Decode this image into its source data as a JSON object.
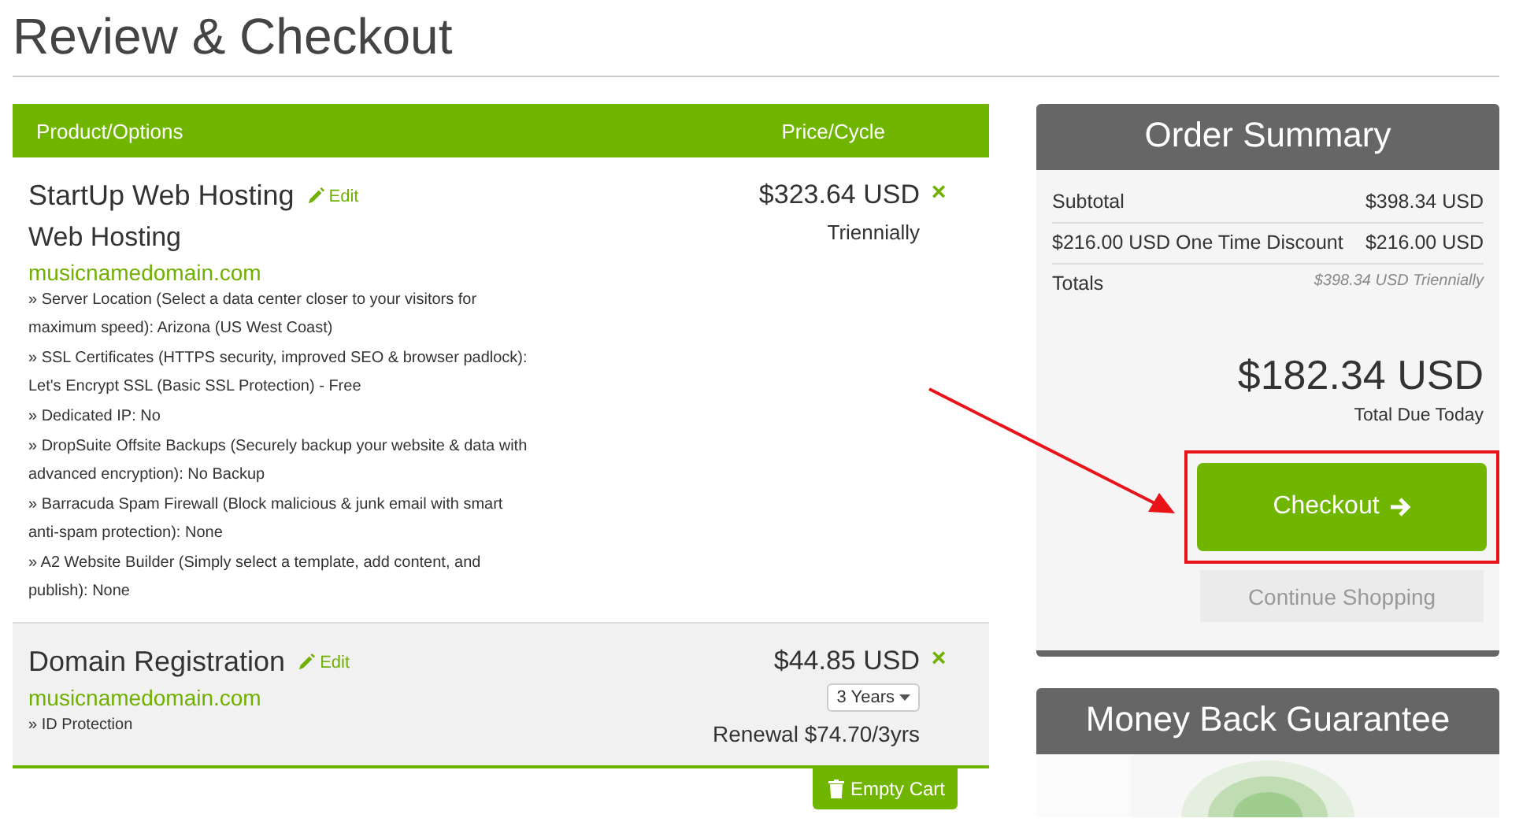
{
  "page_title": "Review & Checkout",
  "cart": {
    "columns": [
      "Product/Options",
      "Price/Cycle"
    ],
    "items": [
      {
        "kind": "product",
        "name": "StartUp Web Hosting",
        "edit": "Edit",
        "group": "Web Hosting",
        "domain": "musicnamedomain.com",
        "options": [
          "» Server Location (Select a data center closer to your visitors for maximum speed): Arizona (US West Coast)",
          "» SSL Certificates (HTTPS security, improved SEO & browser padlock): Let's Encrypt SSL (Basic SSL Protection) - Free",
          "» Dedicated IP: No",
          "» DropSuite Offsite Backups (Securely backup your website & data with advanced encryption): No Backup",
          "» Barracuda Spam Firewall (Block malicious & junk email with smart anti-spam protection): None",
          "» A2 Website Builder (Simply select a template, add content, and publish): None"
        ],
        "price": "$323.64 USD",
        "cycle": "Triennially",
        "remove": "×"
      },
      {
        "kind": "domain",
        "name": "Domain Registration",
        "edit": "Edit",
        "domain": "musicnamedomain.com",
        "options": [
          "» ID Protection"
        ],
        "price": "$44.85 USD",
        "term": "3 Years",
        "renewal": "Renewal $74.70/3yrs",
        "remove": "×"
      }
    ],
    "empty_cart": "Empty Cart"
  },
  "summary": {
    "title": "Order Summary",
    "rows": [
      {
        "label": "Subtotal",
        "value": "$398.34 USD"
      },
      {
        "label": "$216.00 USD One Time Discount",
        "value": "$216.00 USD"
      },
      {
        "label": "Totals",
        "value": "$398.34 USD Triennially"
      }
    ],
    "total": "$182.34 USD",
    "total_label": "Total Due Today",
    "checkout": "Checkout",
    "continue": "Continue Shopping"
  },
  "guarantee": {
    "title": "Money Back Guarantee",
    "kind": "picture"
  }
}
